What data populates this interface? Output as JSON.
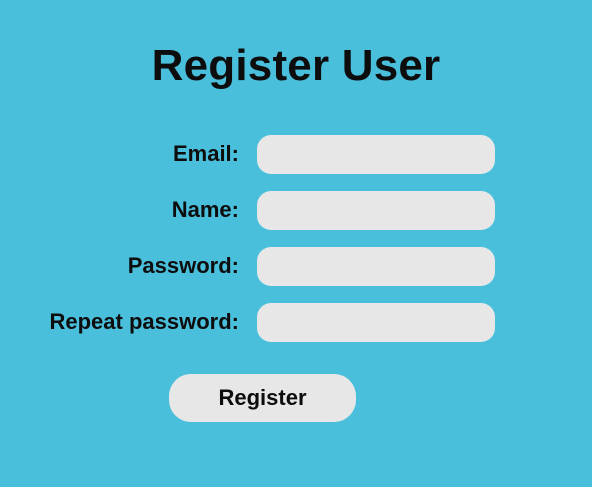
{
  "page": {
    "title": "Register User",
    "background_color": "#49bfdc",
    "input_background": "#e7e7e7"
  },
  "form": {
    "fields": [
      {
        "label": "Email:",
        "value": "",
        "placeholder": ""
      },
      {
        "label": "Name:",
        "value": "",
        "placeholder": ""
      },
      {
        "label": "Password:",
        "value": "",
        "placeholder": ""
      },
      {
        "label": "Repeat password:",
        "value": "",
        "placeholder": ""
      }
    ],
    "submit_label": "Register"
  }
}
